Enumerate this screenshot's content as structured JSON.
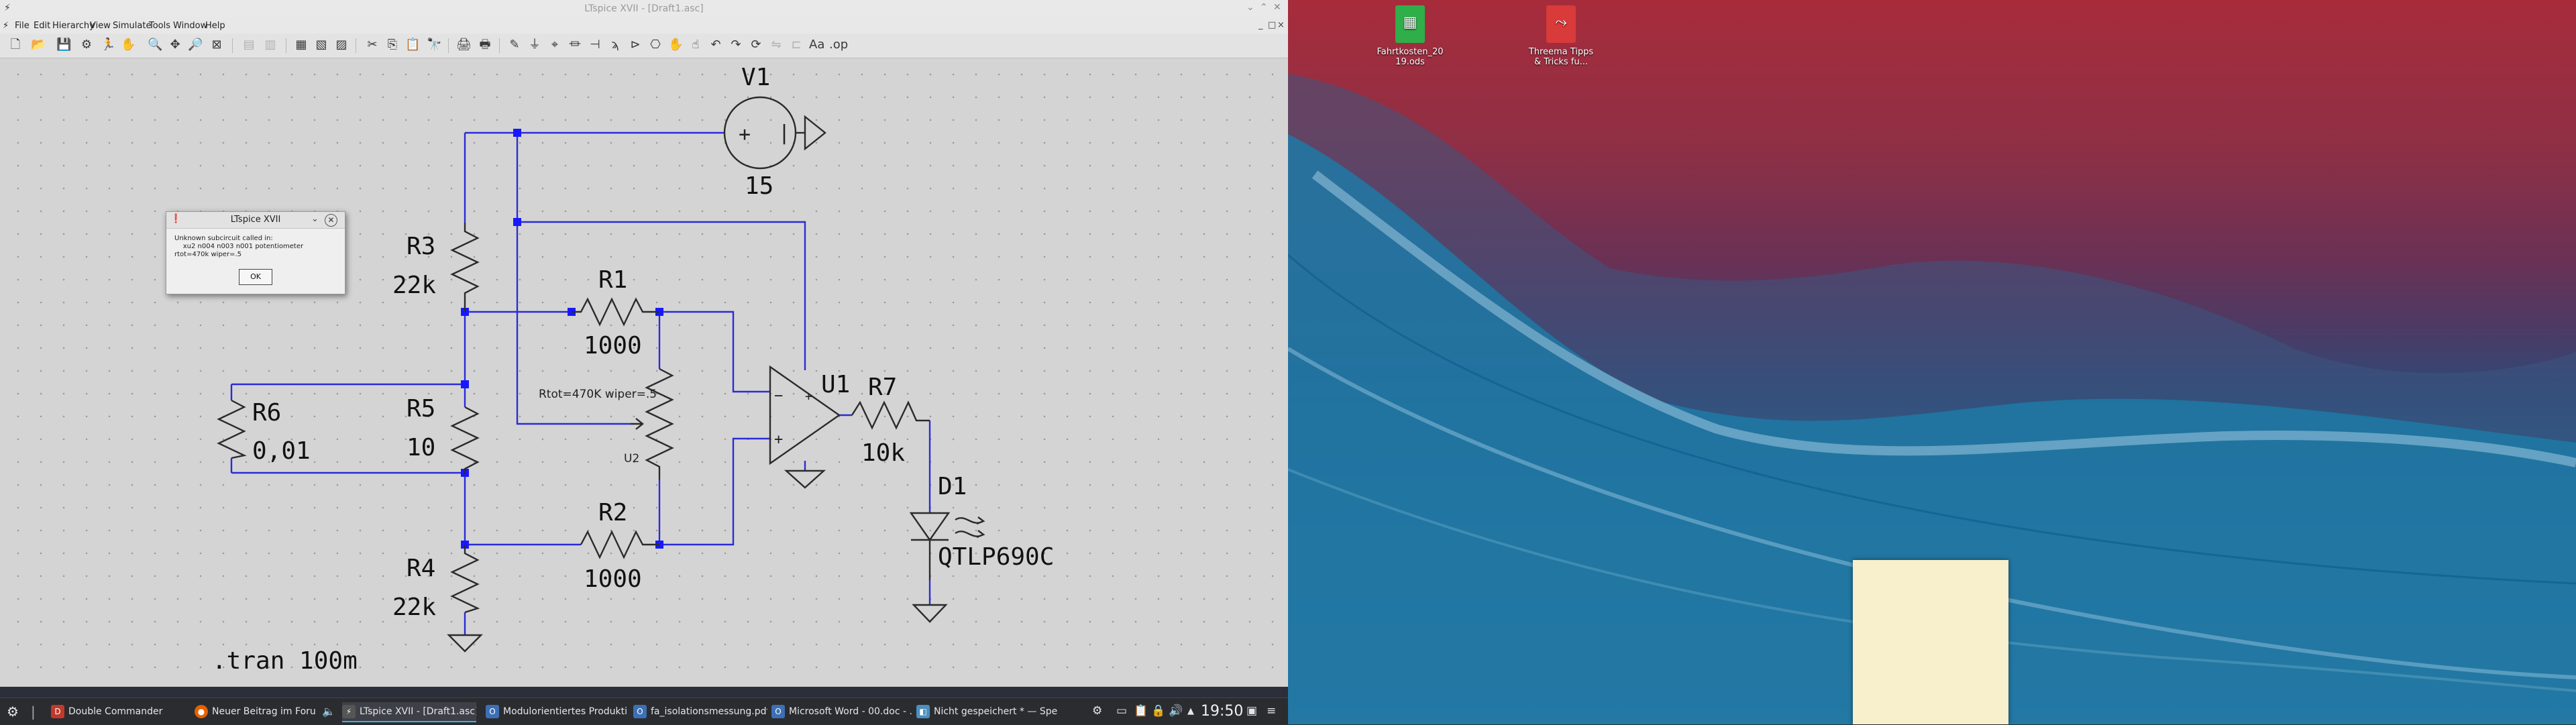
{
  "ltspice": {
    "window_title": "LTspice XVII - [Draft1.asc]",
    "menu": [
      "File",
      "Edit",
      "Hierarchy",
      "View",
      "Simulate",
      "Tools",
      "Window",
      "Help"
    ],
    "mdi_controls": [
      "_",
      "□",
      "×"
    ]
  },
  "dialog": {
    "title": "LTspice XVII",
    "message": "Unknown subcircuit called in:\n    xu2 n004 n003 n001 potentiometer rtot=470k wiper=.5",
    "ok_label": "OK"
  },
  "schematic": {
    "v1_name": "V1",
    "v1_value": "15",
    "r3_name": "R3",
    "r3_value": "22k",
    "r1_name": "R1",
    "r1_value": "1000",
    "r6_name": "R6",
    "r6_value": "0,01",
    "r5_name": "R5",
    "r5_value": "10",
    "r4_name": "R4",
    "r4_value": "22k",
    "r2_name": "R2",
    "r2_value": "1000",
    "u1_name": "U1",
    "r7_name": "R7",
    "r7_value": "10k",
    "d1_name": "D1",
    "d1_value": "QTLP690C",
    "u2_name": "U2",
    "pot_params": "Rtot=470K wiper=.5",
    "directive": ".tran 100m"
  },
  "desktop": {
    "icons": [
      {
        "label_line1": "Fahrtkosten_20",
        "label_line2": "19.ods",
        "color": "#2fae4a"
      },
      {
        "label_line1": "Threema Tipps",
        "label_line2": "& Tricks fu...",
        "color": "#d93a3a"
      }
    ]
  },
  "taskbar": {
    "tasks": [
      {
        "label": "Double Commander",
        "icon": "double-commander-icon",
        "color": "#c0392b"
      },
      {
        "label": "Neuer Beitrag im Foru...",
        "icon": "firefox-icon",
        "color": "#e66000"
      },
      {
        "label": "LTspice XVII - [Draft1.asc]",
        "icon": "ltspice-icon",
        "color": "#555555"
      },
      {
        "label": "Modulorientiertes Produkti...",
        "icon": "pdf-viewer-icon",
        "color": "#3d6fb4"
      },
      {
        "label": "fa_isolationsmessung.pdf ...",
        "icon": "pdf-viewer-icon",
        "color": "#3d6fb4"
      },
      {
        "label": "Microsoft Word - 00.doc - ...",
        "icon": "pdf-viewer-icon",
        "color": "#3d6fb4"
      },
      {
        "label": "Nicht gespeichert * — Spect...",
        "icon": "spectacle-icon",
        "color": "#4a90c0"
      }
    ],
    "clock": "19:50"
  }
}
